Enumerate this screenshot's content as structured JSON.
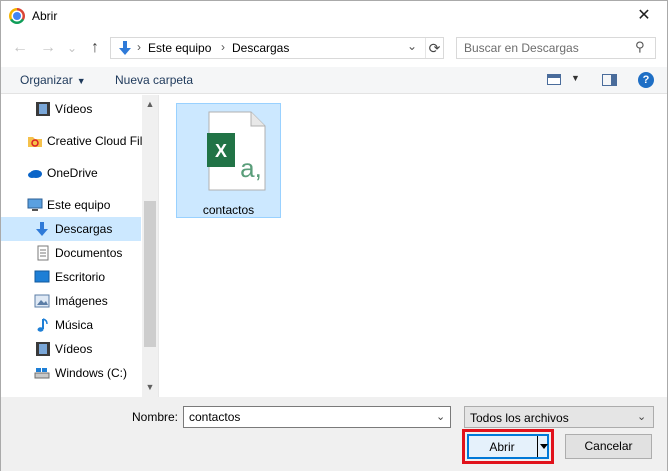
{
  "window": {
    "title": "Abrir",
    "close_glyph": "✕"
  },
  "nav": {
    "back": "←",
    "forward": "→",
    "recent": "⌄",
    "up": "↑"
  },
  "address": {
    "crumbs": [
      "Este equipo",
      "Descargas"
    ],
    "sep": "›",
    "dropdown": "⌄",
    "refresh": "⟳"
  },
  "search": {
    "placeholder": "Buscar en Descargas",
    "value": ""
  },
  "toolbar": {
    "organize": "Organizar",
    "new_folder": "Nueva carpeta",
    "help": "?"
  },
  "sidebar": {
    "items": [
      {
        "label": "Vídeos",
        "icon": "video-folder-icon"
      },
      {
        "label": "Creative Cloud Fil",
        "icon": "creative-cloud-icon"
      },
      {
        "label": "OneDrive",
        "icon": "onedrive-icon"
      },
      {
        "label": "Este equipo",
        "icon": "computer-icon"
      },
      {
        "label": "Descargas",
        "icon": "downloads-icon",
        "selected": true
      },
      {
        "label": "Documentos",
        "icon": "documents-icon"
      },
      {
        "label": "Escritorio",
        "icon": "desktop-icon"
      },
      {
        "label": "Imágenes",
        "icon": "pictures-icon"
      },
      {
        "label": "Música",
        "icon": "music-icon"
      },
      {
        "label": "Vídeos",
        "icon": "video-folder-icon"
      },
      {
        "label": "Windows (C:)",
        "icon": "drive-icon"
      }
    ]
  },
  "files": [
    {
      "name": "contactos",
      "icon": "excel-csv-file-icon",
      "selected": true
    }
  ],
  "bottom": {
    "name_label": "Nombre:",
    "name_value": "contactos",
    "type_value": "Todos los archivos",
    "open_label": "Abrir",
    "cancel_label": "Cancelar"
  },
  "colors": {
    "selection": "#cce8ff",
    "accent": "#0078d7",
    "highlight": "#e1121b",
    "excel_green": "#217346"
  }
}
